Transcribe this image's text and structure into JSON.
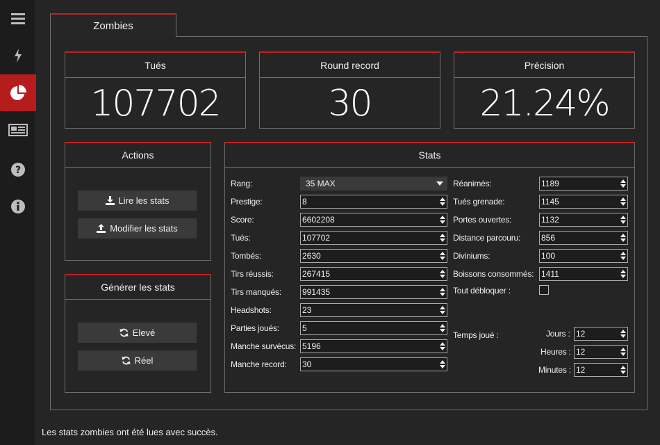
{
  "sidebar": {
    "items": [
      {
        "icon": "menu-icon"
      },
      {
        "icon": "lightning-icon"
      },
      {
        "icon": "pie-chart-icon",
        "active": true
      },
      {
        "icon": "newspaper-icon"
      },
      {
        "icon": "help-icon"
      },
      {
        "icon": "info-icon"
      }
    ]
  },
  "tab": {
    "label": "Zombies"
  },
  "cards": {
    "kills": {
      "title": "Tués",
      "value": "107702"
    },
    "round": {
      "title": "Round record",
      "value": "30"
    },
    "accuracy": {
      "title": "Précision",
      "value": "21.24%"
    }
  },
  "actions": {
    "title": "Actions",
    "read_label": "Lire les stats",
    "edit_label": "Modifier les stats"
  },
  "generate": {
    "title": "Générer les stats",
    "high_label": "Elevé",
    "real_label": "Réel"
  },
  "stats": {
    "title": "Stats",
    "rank": {
      "label": "Rang:",
      "value": "35 MAX"
    },
    "prestige": {
      "label": "Prestige:",
      "value": "8"
    },
    "score": {
      "label": "Score:",
      "value": "6602208"
    },
    "kills": {
      "label": "Tués:",
      "value": "107702"
    },
    "downs": {
      "label": "Tombés:",
      "value": "2630"
    },
    "hits": {
      "label": "Tirs réussis:",
      "value": "267415"
    },
    "misses": {
      "label": "Tirs manqués:",
      "value": "991435"
    },
    "headshots": {
      "label": "Headshots:",
      "value": "23"
    },
    "games": {
      "label": "Parties joués:",
      "value": "5"
    },
    "rounds_survived": {
      "label": "Manche survécus:",
      "value": "5196"
    },
    "round_record": {
      "label": "Manche record:",
      "value": "30"
    },
    "revives": {
      "label": "Réanimés:",
      "value": "1189"
    },
    "grenade_kills": {
      "label": "Tués grenade:",
      "value": "1145"
    },
    "doors": {
      "label": "Portes ouvertes:",
      "value": "1132"
    },
    "distance": {
      "label": "Distance parcouru:",
      "value": "856"
    },
    "divinium": {
      "label": "Diviniums:",
      "value": "100"
    },
    "drinks": {
      "label": "Boissons consommés:",
      "value": "1411"
    },
    "unlock_all": {
      "label": "Tout débloquer :"
    },
    "time_played": {
      "label": "Temps joué :"
    },
    "days": {
      "label": "Jours :",
      "value": "12"
    },
    "hours": {
      "label": "Heures :",
      "value": "12"
    },
    "minutes": {
      "label": "Minutes :",
      "value": "12"
    }
  },
  "status": {
    "message": "Les stats zombies ont été lues avec succès."
  },
  "colors": {
    "accent": "#c02020",
    "active_nav": "#b51d1d",
    "background": "#252525"
  }
}
